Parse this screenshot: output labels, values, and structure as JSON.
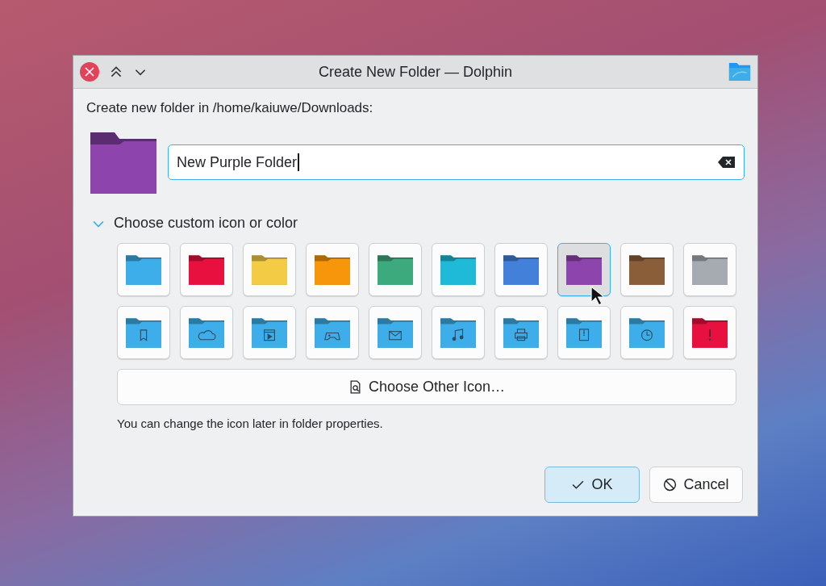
{
  "window": {
    "title": "Create New Folder — Dolphin"
  },
  "prompt": "Create new folder in /home/kaiuwe/Downloads:",
  "preview": {
    "color": "#8e44ad"
  },
  "name_field": {
    "value": "New Purple Folder"
  },
  "custom_section": {
    "label": "Choose custom icon or color",
    "expanded": true
  },
  "icons": [
    {
      "kind": "plain",
      "color": "#3daee9",
      "selected": false
    },
    {
      "kind": "plain",
      "color": "#e8103f",
      "selected": false
    },
    {
      "kind": "plain",
      "color": "#f4cb45",
      "selected": false
    },
    {
      "kind": "plain",
      "color": "#f7960a",
      "selected": false
    },
    {
      "kind": "plain",
      "color": "#3daa7e",
      "selected": false
    },
    {
      "kind": "plain",
      "color": "#20bad9",
      "selected": false
    },
    {
      "kind": "plain",
      "color": "#4280d9",
      "selected": false
    },
    {
      "kind": "plain",
      "color": "#8e44ad",
      "selected": true
    },
    {
      "kind": "plain",
      "color": "#8b5e3a",
      "selected": false
    },
    {
      "kind": "plain",
      "color": "#a6abb1",
      "selected": false
    },
    {
      "kind": "bookmark",
      "color": "#3daee9",
      "selected": false
    },
    {
      "kind": "cloud",
      "color": "#3daee9",
      "selected": false
    },
    {
      "kind": "video",
      "color": "#3daee9",
      "selected": false
    },
    {
      "kind": "games",
      "color": "#3daee9",
      "selected": false
    },
    {
      "kind": "mail",
      "color": "#3daee9",
      "selected": false
    },
    {
      "kind": "music",
      "color": "#3daee9",
      "selected": false
    },
    {
      "kind": "print",
      "color": "#3daee9",
      "selected": false
    },
    {
      "kind": "archive",
      "color": "#3daee9",
      "selected": false
    },
    {
      "kind": "clock",
      "color": "#3daee9",
      "selected": false
    },
    {
      "kind": "important",
      "color": "#e8103f",
      "selected": false
    }
  ],
  "other_icon_button": "Choose Other Icon…",
  "hint": "You can change the icon later in folder properties.",
  "buttons": [
    {
      "kind": "ok",
      "label": "OK"
    },
    {
      "kind": "cancel",
      "label": "Cancel"
    }
  ]
}
